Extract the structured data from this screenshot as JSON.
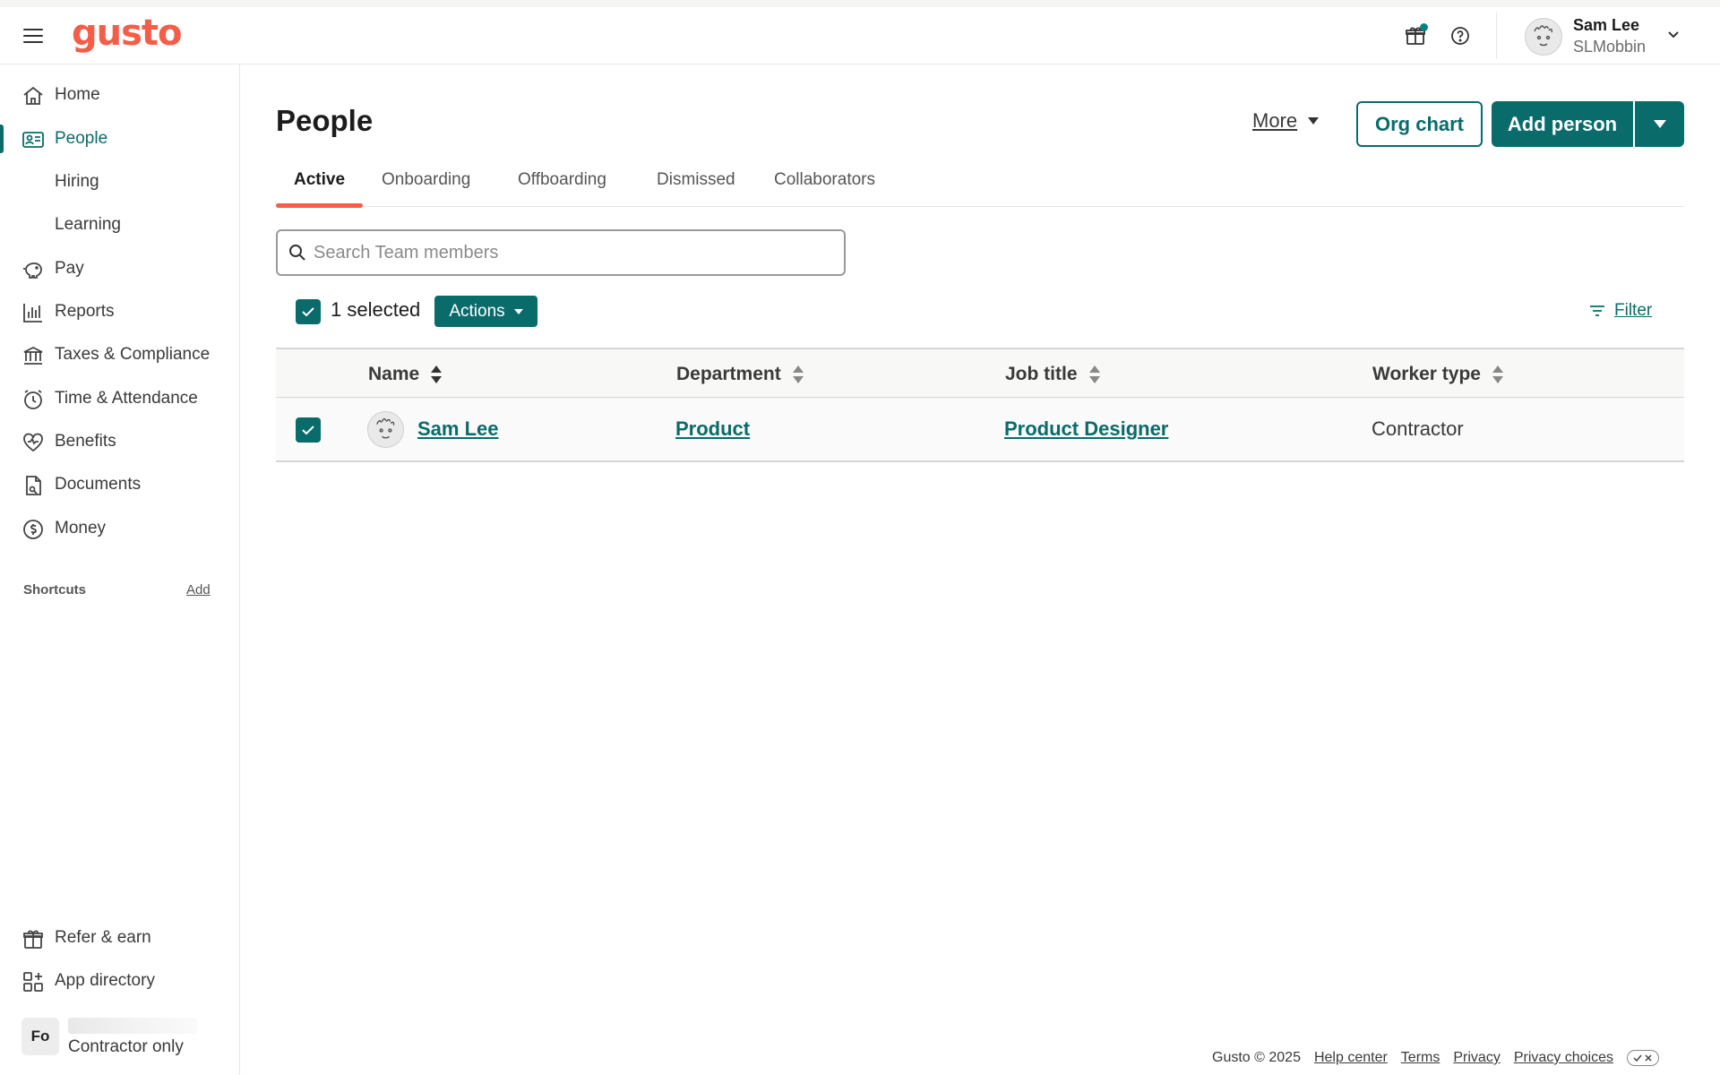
{
  "brand": {
    "logo_text": "gusto",
    "logo_color": "#f45d48",
    "accent": "#0a6b6b"
  },
  "topbar": {
    "menu_icon": "hamburger-icon",
    "gift_icon": "gift-icon",
    "help_icon": "help-icon",
    "user": {
      "name": "Sam Lee",
      "sub": "SLMobbin"
    }
  },
  "sidebar": {
    "items": [
      {
        "label": "Home",
        "icon": "home-icon"
      },
      {
        "label": "People",
        "icon": "people-card-icon",
        "active": true
      },
      {
        "label": "Hiring",
        "icon": ""
      },
      {
        "label": "Learning",
        "icon": ""
      },
      {
        "label": "Pay",
        "icon": "piggy-bank-icon"
      },
      {
        "label": "Reports",
        "icon": "bar-chart-icon"
      },
      {
        "label": "Taxes & Compliance",
        "icon": "bank-icon"
      },
      {
        "label": "Time & Attendance",
        "icon": "clock-icon"
      },
      {
        "label": "Benefits",
        "icon": "heart-icon"
      },
      {
        "label": "Documents",
        "icon": "document-icon"
      },
      {
        "label": "Money",
        "icon": "dollar-icon"
      }
    ],
    "shortcuts": {
      "label": "Shortcuts",
      "add": "Add"
    },
    "bottom": [
      {
        "label": "Refer & earn",
        "icon": "gift-icon"
      },
      {
        "label": "App directory",
        "icon": "apps-grid-icon"
      }
    ],
    "company": {
      "initials": "Fo",
      "type": "Contractor only"
    }
  },
  "main": {
    "title": "People",
    "more_label": "More",
    "org_chart_label": "Org chart",
    "add_person_label": "Add person",
    "tabs": [
      {
        "label": "Active",
        "active": true
      },
      {
        "label": "Onboarding"
      },
      {
        "label": "Offboarding"
      },
      {
        "label": "Dismissed"
      },
      {
        "label": "Collaborators"
      }
    ],
    "search": {
      "placeholder": "Search Team members",
      "value": ""
    },
    "selection": {
      "text": "1 selected",
      "actions_label": "Actions",
      "filter_label": "Filter"
    },
    "table": {
      "columns": [
        "Name",
        "Department",
        "Job title",
        "Worker type"
      ],
      "rows": [
        {
          "name": "Sam Lee",
          "department": "Product",
          "job_title": "Product Designer",
          "worker_type": "Contractor",
          "selected": true
        }
      ]
    }
  },
  "footer": {
    "copyright": "Gusto © 2025",
    "links": [
      "Help center",
      "Terms",
      "Privacy",
      "Privacy choices"
    ]
  }
}
